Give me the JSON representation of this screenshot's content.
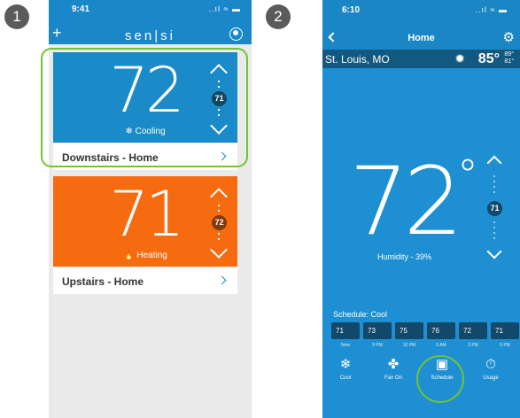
{
  "steps": [
    "1",
    "2"
  ],
  "phone1": {
    "time": "9:41",
    "status": "..ıl ≈ ▬",
    "logo": "sen|si",
    "plus_icon": "plus-icon",
    "profile_icon": "profile-icon",
    "thermostats": [
      {
        "temp": "72",
        "mode": "❄ Cooling",
        "setpoint": "71",
        "name": "Downstairs - Home",
        "color": "#1a8bc8"
      },
      {
        "temp": "71",
        "mode": "🔥 Heating",
        "setpoint": "72",
        "name": "Upstairs - Home",
        "color": "#f66b10"
      }
    ]
  },
  "phone2": {
    "time": "6:10",
    "status": "..ıl ≈ ▬",
    "title": "Home",
    "location": "St. Louis, MO",
    "outdoor_temp": "85°",
    "hi": "89°",
    "lo": "81°",
    "temp": "72",
    "degree": "°",
    "setpoint": "71",
    "humidity": "Humidity - 39%",
    "schedule_label": "Schedule: Cool",
    "schedule": [
      {
        "value": "71",
        "time": "Now"
      },
      {
        "value": "73",
        "time": "9 PM"
      },
      {
        "value": "75",
        "time": "10 PM"
      },
      {
        "value": "76",
        "time": "6 AM"
      },
      {
        "value": "72",
        "time": "3 PM"
      },
      {
        "value": "71",
        "time": "5 PM"
      }
    ],
    "bottom_nav": [
      {
        "icon": "❄",
        "label": "Cool"
      },
      {
        "icon": "✤",
        "label": "Fan On"
      },
      {
        "icon": "▣",
        "label": "Schedule"
      },
      {
        "icon": "⏱",
        "label": "Usage"
      }
    ]
  },
  "accent_green": "#6fc435"
}
